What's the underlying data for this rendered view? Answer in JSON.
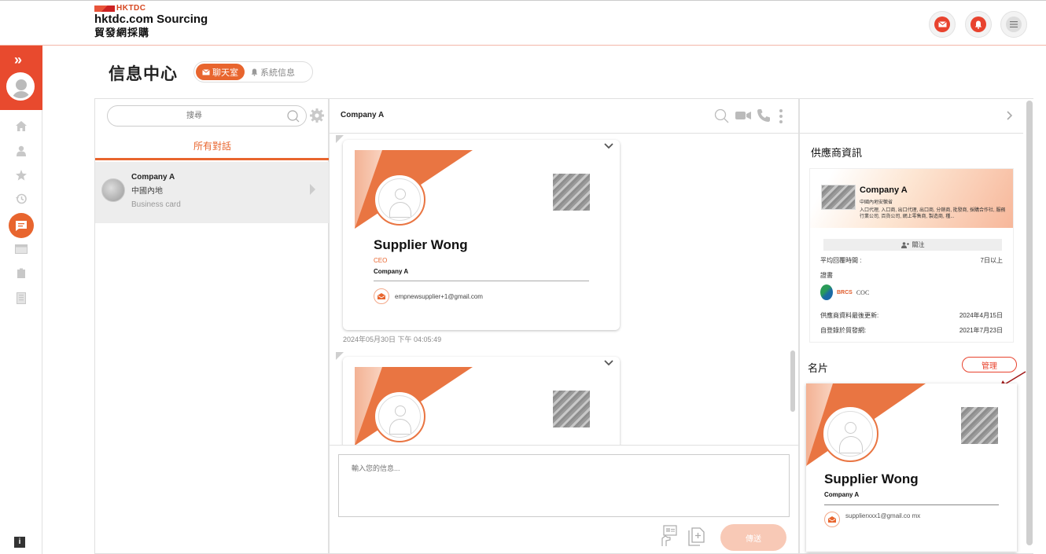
{
  "brand": {
    "tag": "HKTDC",
    "name_en": "hktdc.com Sourcing",
    "name_zh": "貿發網採購"
  },
  "page": {
    "title": "信息中心",
    "tab_chat": "聊天室",
    "tab_system": "系統信息"
  },
  "left": {
    "search_placeholder": "搜尋",
    "all_tab": "所有對話",
    "conversations": [
      {
        "name": "Company A",
        "location": "中國內地",
        "last": "Business card"
      }
    ]
  },
  "chat": {
    "title": "Company A",
    "messages": [
      {
        "card_name": "Supplier Wong",
        "card_title": "CEO",
        "card_company": "Company A",
        "card_email": "empnewsupplier+1@gmail.com",
        "timestamp": "2024年05月30日 下午 04:05:49"
      },
      {
        "card_name": "",
        "card_title": "",
        "card_company": "",
        "card_email": "",
        "timestamp": ""
      }
    ],
    "input_placeholder": "輸入您的信息...",
    "send_label": "傳送"
  },
  "right": {
    "supplier_heading": "供應商資訊",
    "company": "Company A",
    "company_sub": "中國內地安徽省",
    "business_types": "入口代理, 入口商, 出口代理, 出口商, 分銷商, 批發商, 採購合作社, 服務行業公司, 百貨公司, 網上零售商, 製造商, 種...",
    "follow_label": "關注",
    "avg_response_label": "平均回覆時間 :",
    "avg_response_value": "7日以上",
    "cert_label": "證書",
    "cert_brcs": "BRCS",
    "cert_coc": "COC",
    "updated_label": "供應商資料最後更新:",
    "updated_value": "2024年4月15日",
    "registered_label": "自登錄於貿發網:",
    "registered_value": "2021年7月23日",
    "business_card_heading": "名片",
    "manage_label": "管理",
    "card_name": "Supplier Wong",
    "card_company": "Company A",
    "card_email": "supplierxxx1@gmail.co mx"
  },
  "colors": {
    "accent": "#e8652e",
    "brand_red": "#e8432e"
  }
}
